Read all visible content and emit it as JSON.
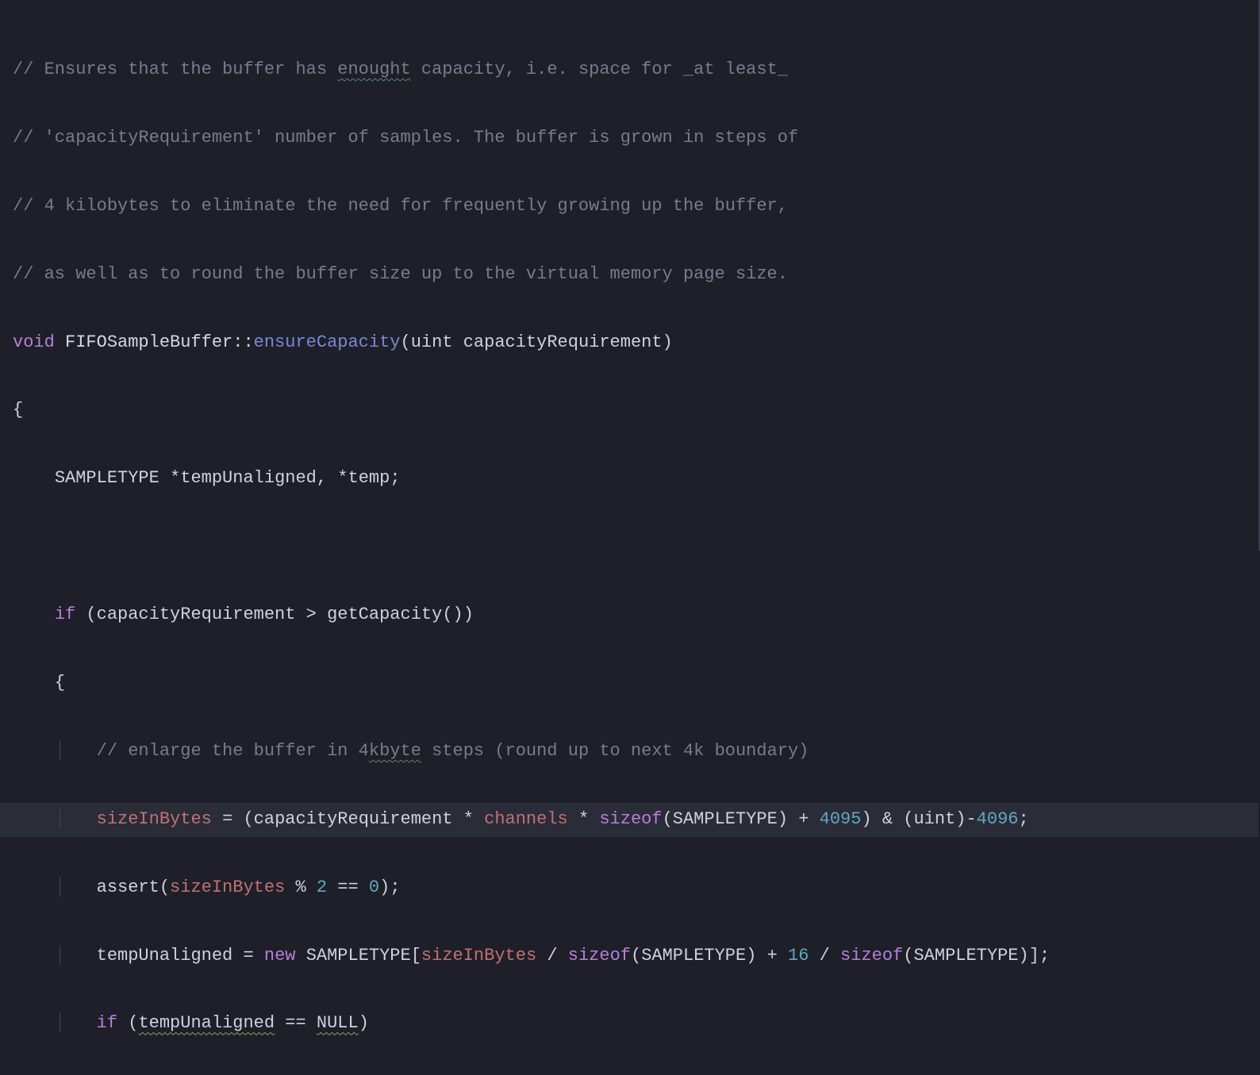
{
  "code": {
    "c1a": "// Ensures that the buffer has ",
    "c1_sq": "enought",
    "c1b": " capacity, i.e. space for _at least_",
    "c2": "// 'capacityRequirement' number of samples. The buffer is grown in steps of",
    "c3": "// 4 kilobytes to eliminate the need for frequently growing up the buffer,",
    "c4": "// as well as to round the buffer size up to the virtual memory page size.",
    "kw_void": "void",
    "class": "FIFOSampleBuffer",
    "scope": "::",
    "method": "ensureCapacity",
    "lp": "(",
    "rp": ")",
    "uint": "uint",
    "param": "capacityRequirement",
    "lbrace": "{",
    "rbrace": "}",
    "sampletype": "SAMPLETYPE",
    "star": "*",
    "tempU": "tempUnaligned",
    "comma": ",",
    "temp": "temp",
    "semi": ";",
    "if": "if",
    "gt": ">",
    "getCap": "getCapacity",
    "c5a": "// enlarge the buffer in 4",
    "c5_sq": "kbyte",
    "c5b": " steps (round up to next 4k boundary)",
    "sizeInBytes": "sizeInBytes",
    "eq": "=",
    "channels": "channels",
    "sizeof": "sizeof",
    "plus": "+",
    "n4095": "4095",
    "amp": "&",
    "minus": "-",
    "n4096": "4096",
    "assert": "assert",
    "pct": "%",
    "n2": "2",
    "eqeq": "==",
    "n0": "0",
    "new": "new",
    "lbr": "[",
    "rbr": "]",
    "slash": "/",
    "n16": "16",
    "null": "NULL"
  }
}
